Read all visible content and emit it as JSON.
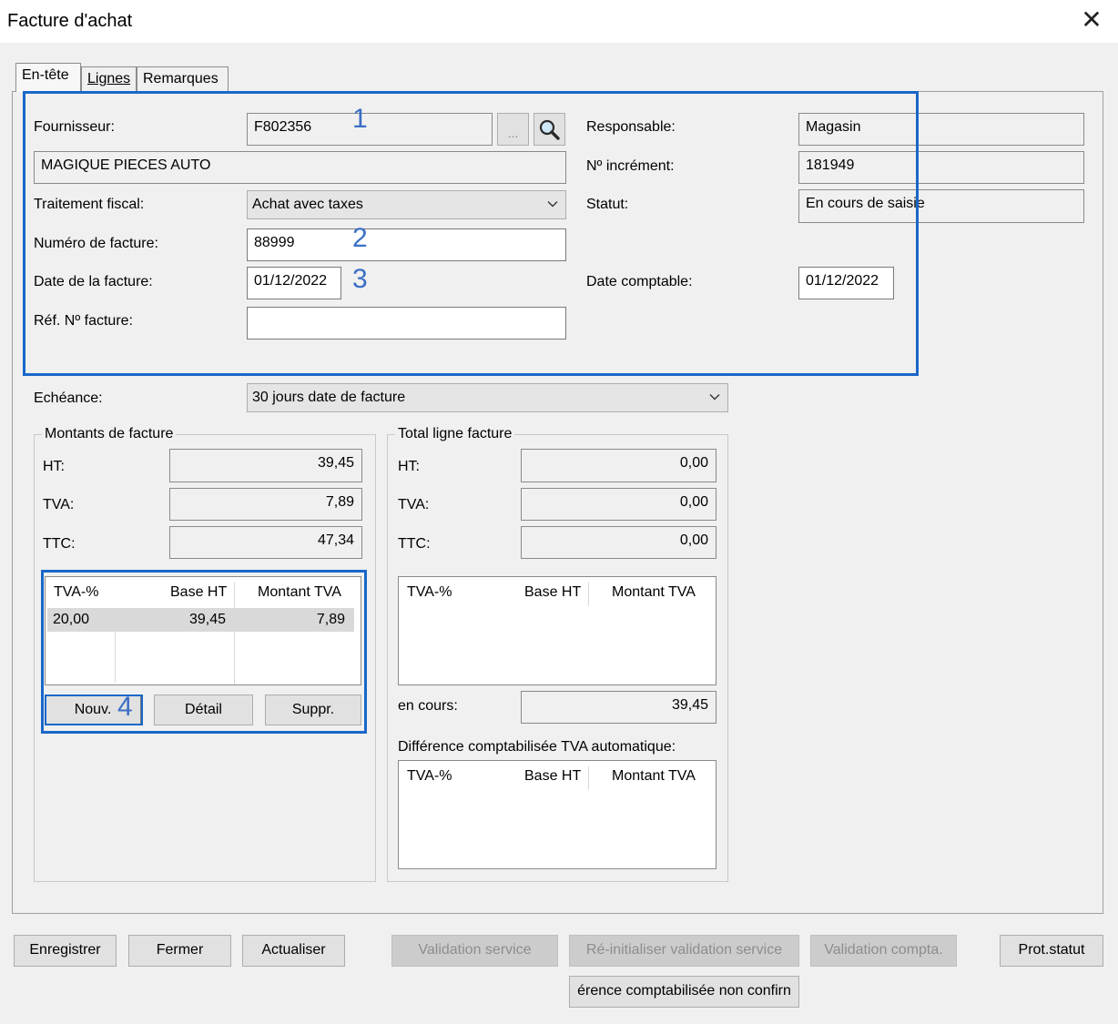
{
  "window": {
    "title": "Facture d'achat",
    "close_glyph": "✕"
  },
  "tabs": [
    {
      "label": "En-tête"
    },
    {
      "label": "Lignes"
    },
    {
      "label": "Remarques"
    }
  ],
  "header": {
    "fournisseur_label": "Fournisseur:",
    "fournisseur_value": "F802356",
    "browse_label": "...",
    "supplier_name": "MAGIQUE PIECES AUTO",
    "traitement_label": "Traitement fiscal:",
    "traitement_value": "Achat avec taxes",
    "numero_label": "Numéro de facture:",
    "numero_value": "88999",
    "date_label": "Date de la facture:",
    "date_value": "01/12/2022",
    "ref_label": "Réf. Nº facture:",
    "ref_value": "",
    "responsable_label": "Responsable:",
    "responsable_value": "Magasin",
    "increment_label": "Nº incrément:",
    "increment_value": "181949",
    "statut_label": "Statut:",
    "statut_value": "En cours de saisie",
    "date_comptable_label": "Date comptable:",
    "date_comptable_value": "01/12/2022"
  },
  "annotations": [
    "1",
    "2",
    "3",
    "4"
  ],
  "echeance": {
    "label": "Echéance:",
    "value": "30 jours date de facture"
  },
  "montants": {
    "title": "Montants de facture",
    "ht_label": "HT:",
    "ht_value": "39,45",
    "tva_label": "TVA:",
    "tva_value": "7,89",
    "ttc_label": "TTC:",
    "ttc_value": "47,34",
    "grid_headers": [
      "TVA-%",
      "Base HT",
      "Montant TVA"
    ],
    "grid_rows": [
      [
        "20,00",
        "39,45",
        "7,89"
      ]
    ],
    "btn_nouv": "Nouv.",
    "btn_detail": "Détail",
    "btn_suppr": "Suppr."
  },
  "total_ligne": {
    "title": "Total ligne facture",
    "ht_label": "HT:",
    "ht_value": "0,00",
    "tva_label": "TVA:",
    "tva_value": "0,00",
    "ttc_label": "TTC:",
    "ttc_value": "0,00",
    "grid_headers": [
      "TVA-%",
      "Base HT",
      "Montant TVA"
    ],
    "en_cours_label": "en cours:",
    "en_cours_value": "39,45",
    "diff_label": "Différence comptabilisée TVA automatique:",
    "diff_headers": [
      "TVA-%",
      "Base HT",
      "Montant TVA"
    ]
  },
  "footer": {
    "enregistrer": "Enregistrer",
    "fermer": "Fermer",
    "actualiser": "Actualiser",
    "validation_service": "Validation service",
    "reinit_validation": "Ré-initialiser validation service",
    "validation_compta": "Validation compta.",
    "prot_statut": "Prot.statut",
    "diff_non_confirm": "érence comptabilisée non confirn"
  },
  "colors": {
    "annotation_box": "#1967c9",
    "annotation_text": "#3a6fc4"
  }
}
